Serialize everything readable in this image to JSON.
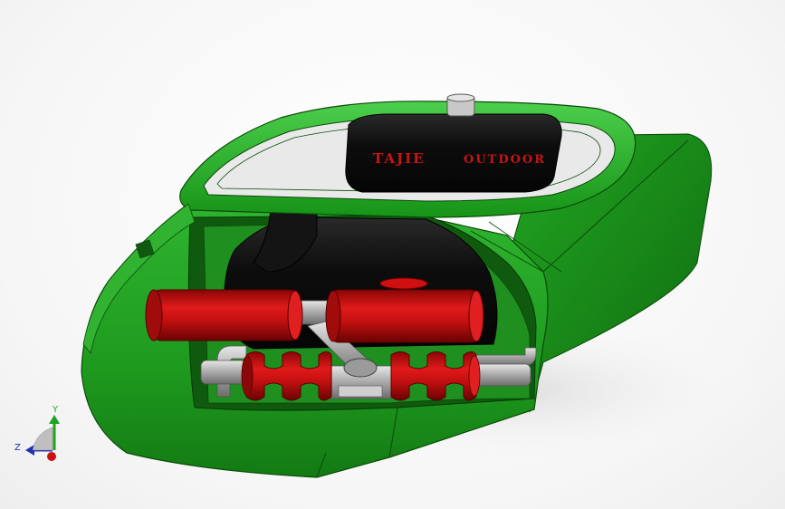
{
  "model": {
    "brand_left": "TAJIE",
    "brand_right": "OUTDOOR"
  },
  "triad": {
    "y_label": "Y",
    "z_label": "Z"
  },
  "colors": {
    "hull": "#1e9e1e",
    "hull_dark": "#0f6e0f",
    "hull_light": "#3fc43f",
    "roller_red": "#cc1010",
    "roller_dark": "#7a0404",
    "tank_black": "#111111",
    "pipe_gray": "#b4b4b4",
    "brand_text": "#c81414"
  }
}
